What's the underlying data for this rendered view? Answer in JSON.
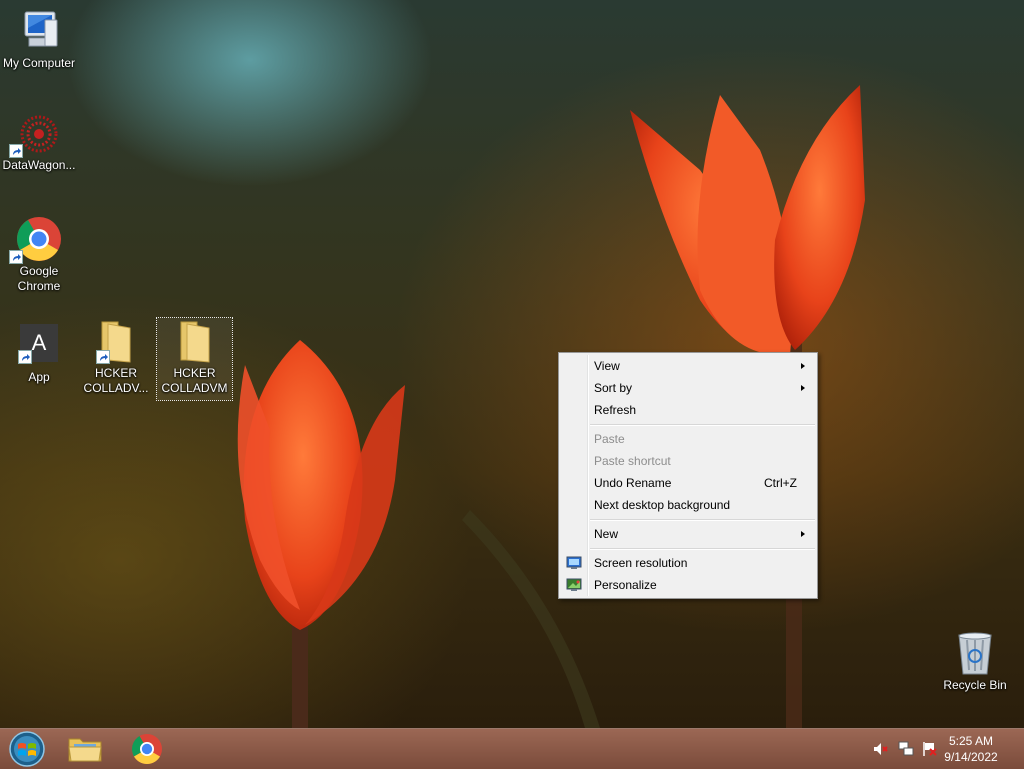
{
  "desktop_icons": [
    {
      "label": "My Computer"
    },
    {
      "label": "DataWagon..."
    },
    {
      "label_line1": "Google",
      "label_line2": "Chrome"
    },
    {
      "label": "App",
      "letter": "A"
    },
    {
      "label_line1": "HCKER",
      "label_line2": "COLLADV..."
    },
    {
      "label_line1": "HCKER",
      "label_line2": "COLLADVM"
    },
    {
      "label": "Recycle Bin"
    }
  ],
  "context_menu": {
    "items": [
      {
        "label": "View",
        "submenu": true,
        "enabled": true
      },
      {
        "label": "Sort by",
        "submenu": true,
        "enabled": true
      },
      {
        "label": "Refresh",
        "enabled": true
      },
      {
        "label": "Paste",
        "enabled": false
      },
      {
        "label": "Paste shortcut",
        "enabled": false
      },
      {
        "label": "Undo Rename",
        "shortcut": "Ctrl+Z",
        "enabled": true
      },
      {
        "label": "Next desktop background",
        "enabled": true
      },
      {
        "label": "New",
        "submenu": true,
        "enabled": true
      },
      {
        "label": "Screen resolution",
        "icon": "monitor-icon",
        "enabled": true
      },
      {
        "label": "Personalize",
        "icon": "personalize-icon",
        "enabled": true
      }
    ]
  },
  "taskbar": {
    "pinned": [
      {
        "name": "start-button"
      },
      {
        "name": "file-explorer"
      },
      {
        "name": "google-chrome"
      }
    ],
    "tray_icons": [
      "volume-muted-icon",
      "network-icon",
      "action-center-flag-icon"
    ],
    "clock": {
      "time": "5:25 AM",
      "date": "9/14/2022"
    }
  }
}
